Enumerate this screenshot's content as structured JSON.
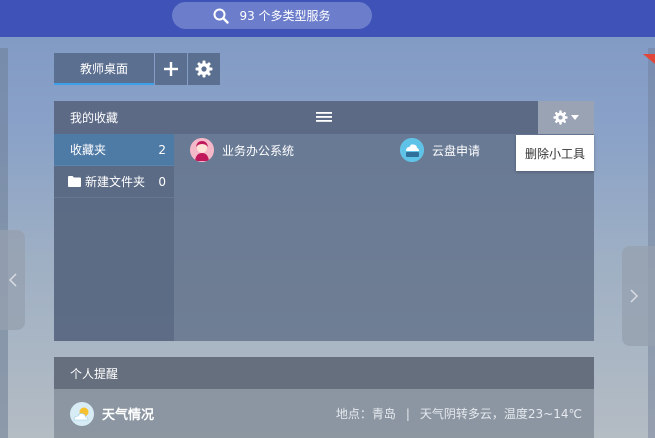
{
  "search": {
    "label": "93 个多类型服务"
  },
  "tabs": {
    "main_label": "教师桌面"
  },
  "favorites": {
    "title": "我的收藏",
    "sidebar": [
      {
        "label": "收藏夹",
        "count": "2"
      },
      {
        "label": "新建文件夹",
        "count": "0"
      }
    ],
    "entries": [
      {
        "label": "业务办公系统"
      },
      {
        "label": "云盘申请"
      }
    ],
    "tooltip": "删除小工具"
  },
  "reminder": {
    "title": "个人提醒",
    "weather": {
      "title": "天气情况",
      "location": "地点：青岛",
      "separator": "|",
      "forecast": "天气阴转多云，温度23~14℃"
    }
  },
  "colors": {
    "topbar": "#3f52b8",
    "search_pill": "#6c7ecb",
    "active_tab_underline": "#3aa0e8",
    "active_sidebar": "#4e7aa6",
    "corner_flag": "#e0463a"
  }
}
